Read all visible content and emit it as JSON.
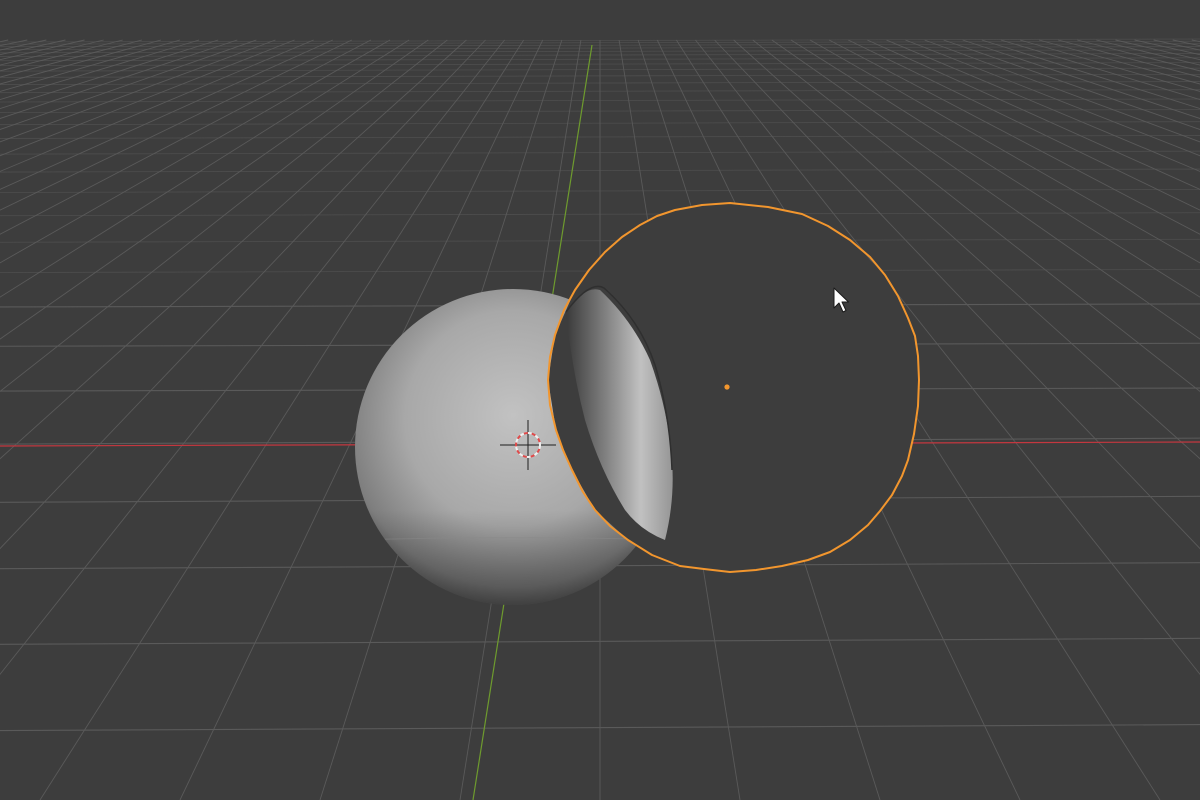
{
  "app": {
    "editor": "3D Viewport"
  },
  "colors": {
    "background": "#3d3d3d",
    "grid_line": "#4e4e4e",
    "grid_line_near": "#5a5a5a",
    "x_axis": "#c4373f",
    "y_axis": "#6e9b2e",
    "selection_outline": "#f2962e",
    "origin_dot": "#f2962e",
    "sphere_light": "#c4c4c4",
    "sphere_mid": "#9a9a9a",
    "sphere_dark": "#4a4a4a",
    "cursor_3d_ring_red": "#e04a4a",
    "cursor_3d_ring_white": "#f0f0f0",
    "mouse_pointer": "#ffffff"
  },
  "scene": {
    "objects": [
      {
        "name_icon": "uv-sphere",
        "selected": false,
        "shading": "solid"
      },
      {
        "name_icon": "uv-sphere",
        "selected": true,
        "shading": "solid"
      }
    ],
    "grid": true,
    "axes_shown": [
      "x",
      "y"
    ],
    "cursor_3d": true,
    "mouse_pointer": "arrow-pointer-icon"
  }
}
